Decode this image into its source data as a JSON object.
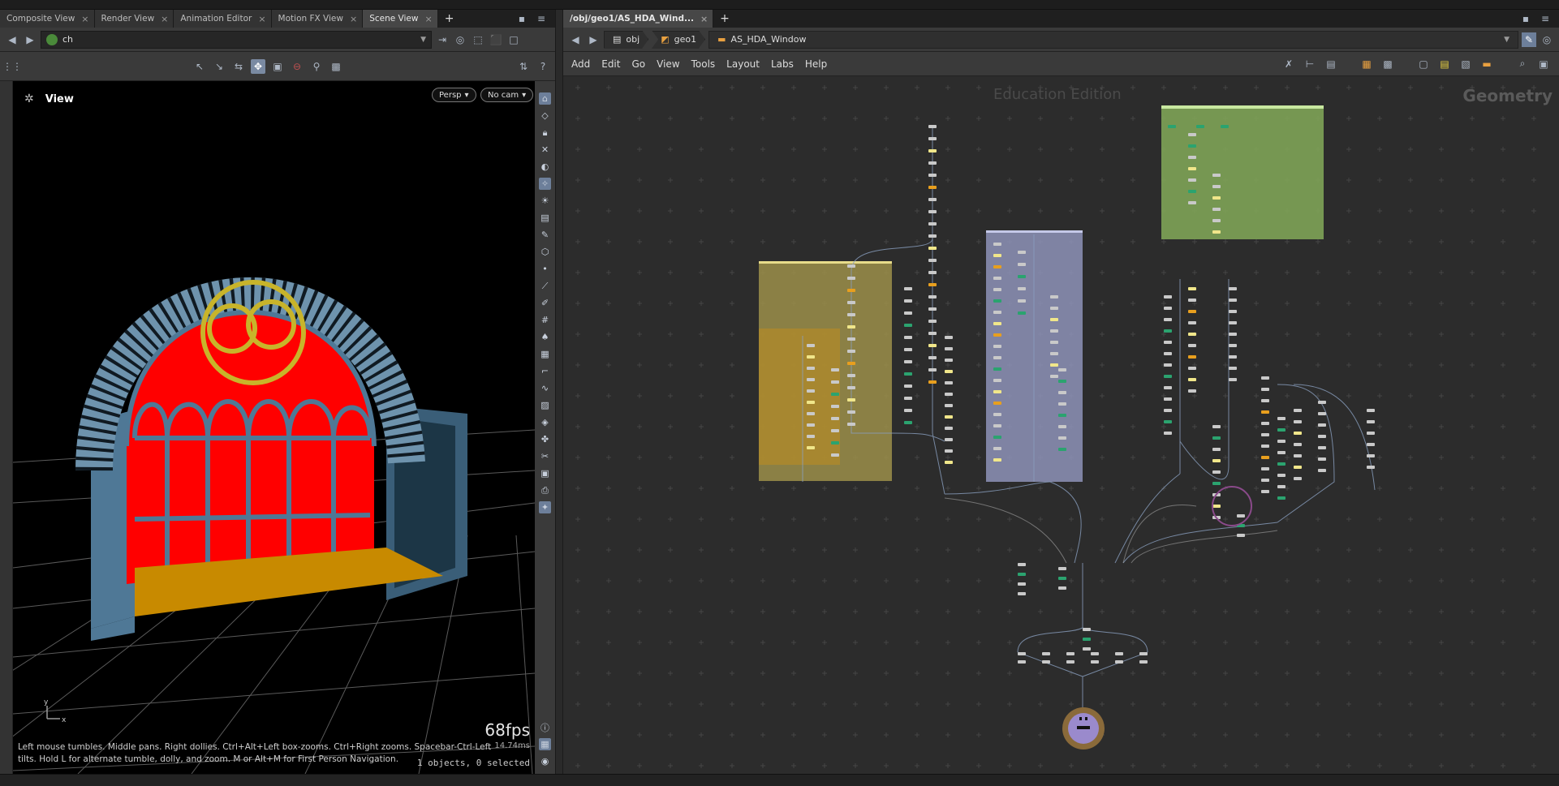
{
  "left_pane": {
    "tabs": [
      {
        "label": "Composite View"
      },
      {
        "label": "Render View"
      },
      {
        "label": "Animation Editor"
      },
      {
        "label": "Motion FX View"
      },
      {
        "label": "Scene View"
      }
    ],
    "path_value": "ch",
    "viewport": {
      "title": "View",
      "persp_label": "Persp",
      "cam_label": "No cam",
      "fps": "68fps",
      "ms": "14.74ms",
      "hint": "Left mouse tumbles. Middle pans. Right dollies. Ctrl+Alt+Left box-zooms. Ctrl+Right zooms. Spacebar-Ctrl-Left tilts. Hold L for alternate tumble, dolly, and zoom. M or Alt+M for First Person Navigation.",
      "selection": "1 objects, 0 selected",
      "axis_x": "x",
      "axis_y": "y"
    }
  },
  "right_pane": {
    "tab_label": "/obj/geo1/AS_HDA_Wind...",
    "breadcrumbs": [
      {
        "label": "obj"
      },
      {
        "label": "geo1"
      }
    ],
    "current_node": "AS_HDA_Window",
    "menu": [
      "Add",
      "Edit",
      "Go",
      "View",
      "Tools",
      "Layout",
      "Labs",
      "Help"
    ],
    "watermark": "Education Edition",
    "context_label": "Geometry"
  },
  "colors": {
    "window_red": "#ff0000",
    "frame_blue": "#4f7896",
    "ring_yellow": "#c8b42a",
    "floor_orange": "#c88a00",
    "box_yellow": "#9c8f4a",
    "box_purple": "#8e93b8",
    "box_green": "#7ea356",
    "node_gray": "#c9c9c9",
    "node_orange": "#e89f1e",
    "node_green": "#2ba36f",
    "node_yellow": "#f0e68a"
  }
}
